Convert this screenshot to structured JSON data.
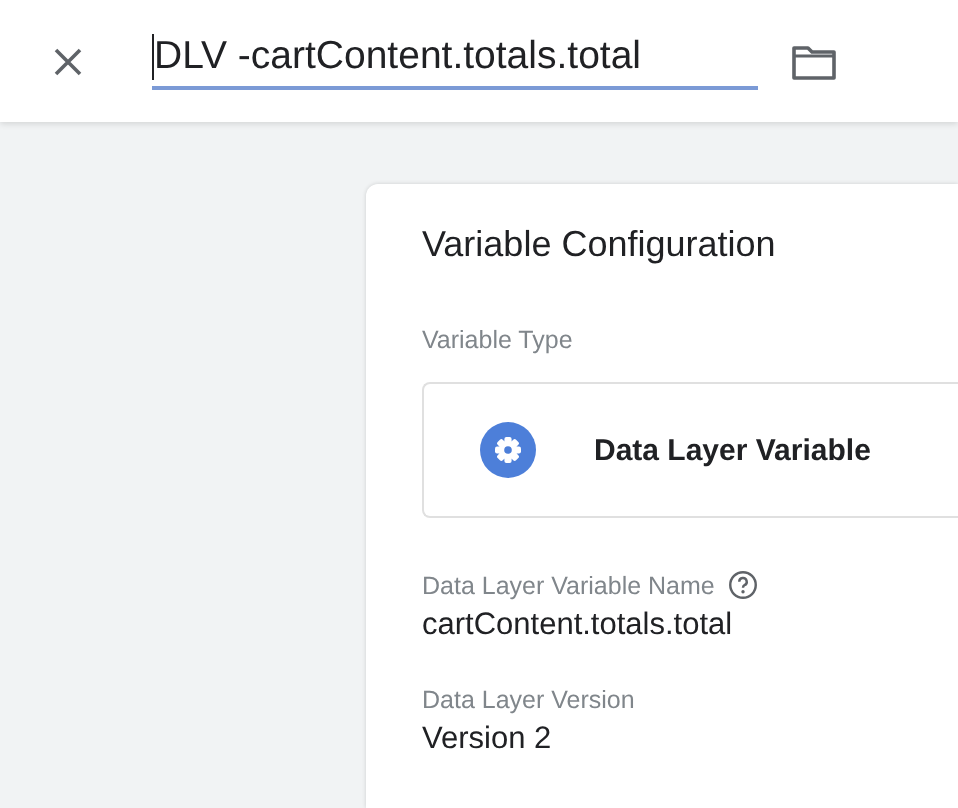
{
  "header": {
    "name_field": {
      "value": "DLV -cartContent.totals.total"
    }
  },
  "card": {
    "title": "Variable Configuration",
    "variable_type": {
      "label": "Variable Type",
      "name": "Data Layer Variable"
    },
    "fields": [
      {
        "label": "Data Layer Variable Name",
        "help": true,
        "value": "cartContent.totals.total"
      },
      {
        "label": "Data Layer Version",
        "help": false,
        "value": "Version 2"
      }
    ]
  }
}
